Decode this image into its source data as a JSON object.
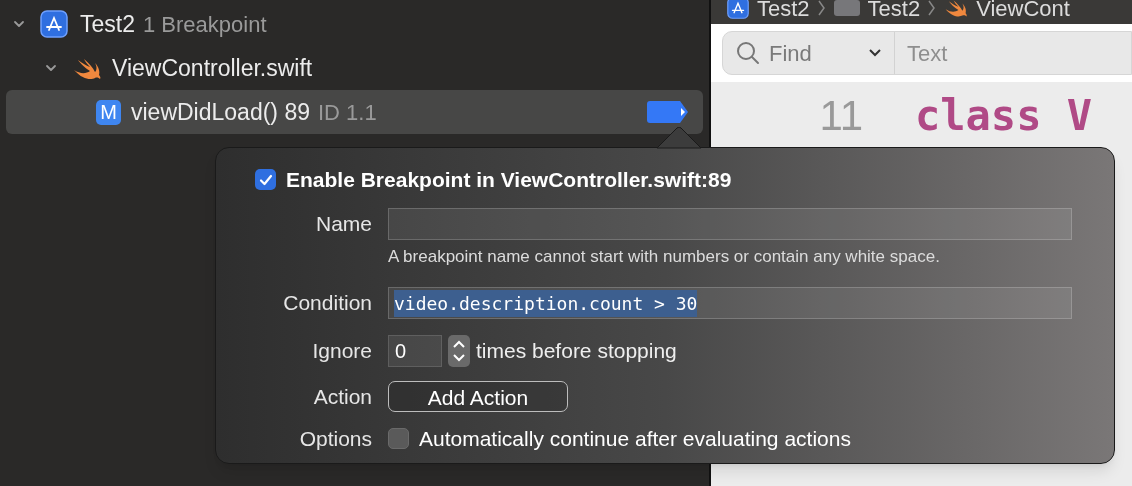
{
  "navigator": {
    "items": [
      {
        "kind": "project",
        "label": "Test2",
        "detail": "1 Breakpoint",
        "expanded": true,
        "selected": false,
        "children": [
          {
            "kind": "file",
            "label": "ViewController.swift",
            "expanded": true,
            "selected": false,
            "children": [
              {
                "kind": "breakpoint",
                "badge": "M",
                "label": "viewDidLoad() 89",
                "detail": "ID 1.1",
                "selected": true,
                "enabled": true
              }
            ]
          }
        ]
      }
    ]
  },
  "editor": {
    "breadcrumbs": [
      "Test2",
      "Test2",
      "ViewCont"
    ],
    "find": {
      "mode": "Find",
      "placeholder": "Text"
    },
    "lines": [
      {
        "number": "11",
        "code": "class V"
      }
    ]
  },
  "popover": {
    "enable": {
      "label": "Enable Breakpoint in ViewController.swift:89",
      "checked": true
    },
    "name": {
      "label": "Name",
      "hint": "A breakpoint name cannot start with numbers or contain any white space."
    },
    "condition": {
      "label": "Condition",
      "value": "video.description.count > 30",
      "selected": true
    },
    "ignore": {
      "label": "Ignore",
      "value": "0",
      "suffix": "times before stopping"
    },
    "action": {
      "label": "Action",
      "button": "Add Action"
    },
    "options": {
      "label": "Options",
      "text": "Automatically continue after evaluating actions",
      "checked": false
    }
  }
}
